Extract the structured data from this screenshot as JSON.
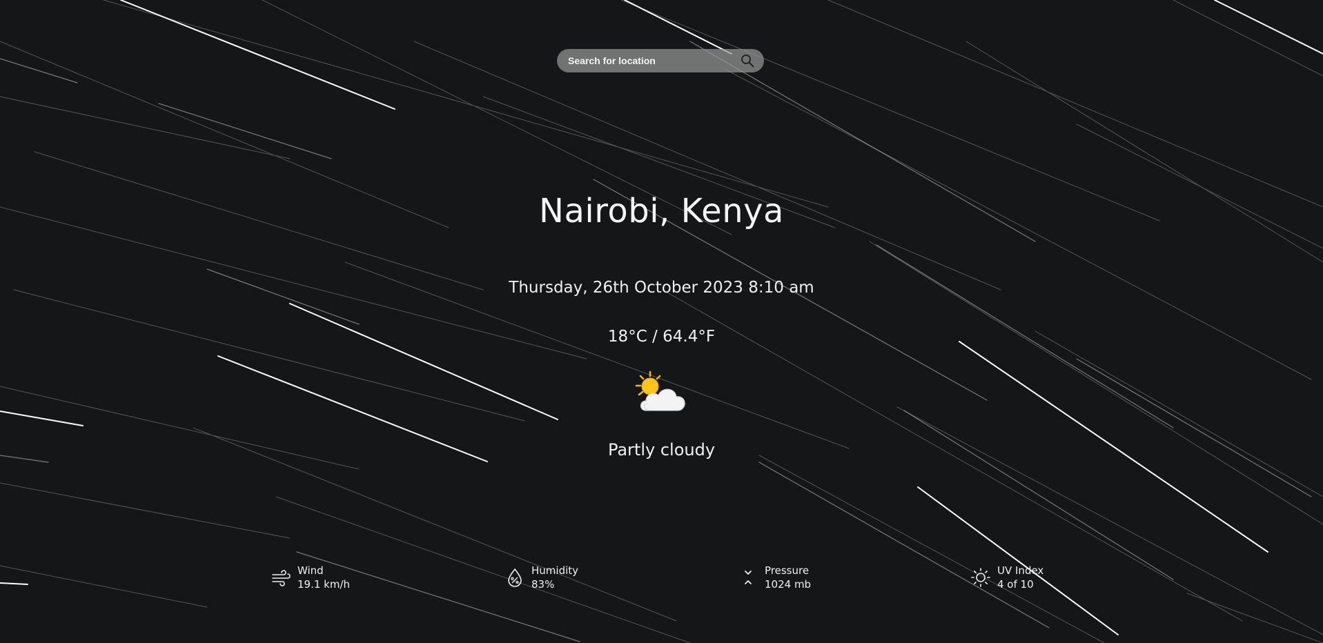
{
  "search": {
    "placeholder": "Search for location",
    "icon": "search-icon"
  },
  "location": {
    "title": "Nairobi, Kenya"
  },
  "datetime": "Thursday, 26th October 2023 8:10 am",
  "temperature": "18°C / 64.4°F",
  "condition": {
    "icon": "partly-cloudy-icon",
    "text": "Partly cloudy"
  },
  "stats": {
    "wind": {
      "label": "Wind",
      "value": "19.1 km/h",
      "icon": "wind-icon"
    },
    "humidity": {
      "label": "Humidity",
      "value": "83%",
      "icon": "humidity-icon"
    },
    "pressure": {
      "label": "Pressure",
      "value": "1024 mb",
      "icon": "pressure-icon"
    },
    "uv": {
      "label": "UV Index",
      "value": "4 of 10",
      "icon": "sun-icon"
    }
  },
  "colors": {
    "background": "#151617",
    "search_bg": "#969696",
    "text": "#f2f2f2",
    "sun": "#f7b500"
  }
}
